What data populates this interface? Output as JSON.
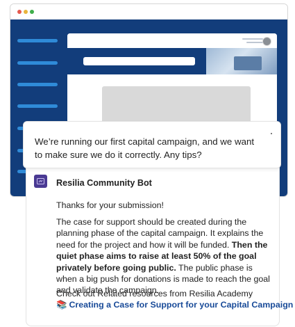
{
  "question": {
    "text": "We’re running our first capital campaign, and we want to make sure we do it correctly. Any tips?"
  },
  "bot": {
    "name": "Resilia Community Bot",
    "icon": "bot-avatar-icon",
    "thanks": "Thanks for your submission!",
    "paragraph_start": "The case for support should be created during the planning phase of the capital campaign. It explains the need for the project and how it will be funded. ",
    "paragraph_bold": "Then the quiet phase aims to raise at least 50% of the goal privately before going public.",
    "paragraph_end": " The public phase is when a big push for donations is made to reach the goal and validate the campaign.",
    "resources_intro": "Check out Related resources from Resilia Academy",
    "resource_icon": "book-stack-icon",
    "resource_link": "Creating a Case for Support for your Capital Campaign"
  },
  "colors": {
    "app_navy": "#123d7b",
    "nav_accent": "#2f8bd8",
    "bot_purple": "#4a3a93",
    "link_blue": "#184a98"
  }
}
